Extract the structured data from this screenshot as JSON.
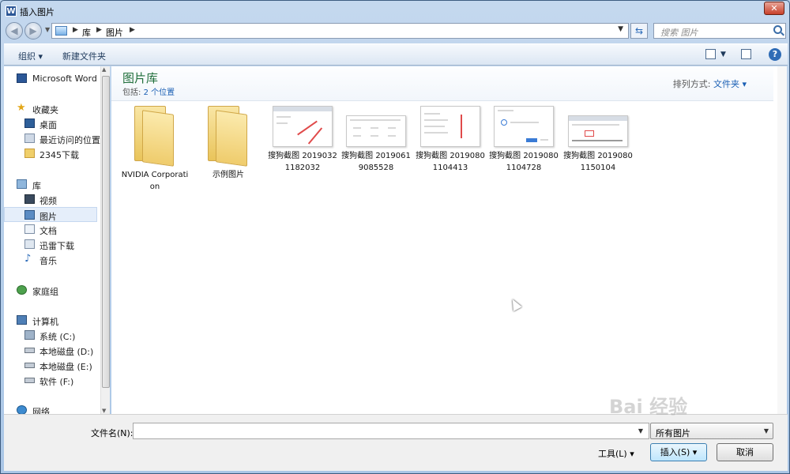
{
  "window": {
    "title": "插入图片",
    "app_icon_letter": "W",
    "close_label": "✕"
  },
  "navbar": {
    "breadcrumbs": [
      "库",
      "图片"
    ],
    "search_placeholder": "搜索 图片"
  },
  "toolbar": {
    "organize": "组织",
    "new_folder": "新建文件夹"
  },
  "sidebar": {
    "items": [
      {
        "label": "Microsoft Word",
        "icon": "word-icon",
        "level": 0
      },
      {
        "label": "收藏夹",
        "icon": "star-icon",
        "level": 0
      },
      {
        "label": "桌面",
        "icon": "desktop-icon",
        "level": 1
      },
      {
        "label": "最近访问的位置",
        "icon": "recent-places-icon",
        "level": 1
      },
      {
        "label": "2345下载",
        "icon": "folder-icon",
        "level": 1
      },
      {
        "label": "库",
        "icon": "library-icon",
        "level": 0
      },
      {
        "label": "视频",
        "icon": "video-icon",
        "level": 1
      },
      {
        "label": "图片",
        "icon": "pictures-icon",
        "level": 1,
        "selected": true
      },
      {
        "label": "文档",
        "icon": "documents-icon",
        "level": 1
      },
      {
        "label": "迅雷下载",
        "icon": "download-folder-icon",
        "level": 1
      },
      {
        "label": "音乐",
        "icon": "music-icon",
        "level": 1
      },
      {
        "label": "家庭组",
        "icon": "homegroup-icon",
        "level": 0
      },
      {
        "label": "计算机",
        "icon": "computer-icon",
        "level": 0
      },
      {
        "label": "系统 (C:)",
        "icon": "drive-c-icon",
        "level": 1
      },
      {
        "label": "本地磁盘 (D:)",
        "icon": "drive-icon",
        "level": 1
      },
      {
        "label": "本地磁盘 (E:)",
        "icon": "drive-icon",
        "level": 1
      },
      {
        "label": "软件 (F:)",
        "icon": "drive-icon",
        "level": 1
      },
      {
        "label": "网络",
        "icon": "network-icon",
        "level": 0
      }
    ]
  },
  "library": {
    "title": "图片库",
    "includes_label": "包括:",
    "includes_link": "2 个位置",
    "arrange_label": "排列方式:",
    "arrange_value": "文件夹"
  },
  "files": [
    {
      "name": "NVIDIA Corporation",
      "kind": "folder"
    },
    {
      "name": "示例图片",
      "kind": "folder"
    },
    {
      "name": "搜狗截图 20190321182032",
      "kind": "screenshot"
    },
    {
      "name": "搜狗截图 20190619085528",
      "kind": "screenshot"
    },
    {
      "name": "搜狗截图 20190801104413",
      "kind": "screenshot"
    },
    {
      "name": "搜狗截图 20190801104728",
      "kind": "screenshot"
    },
    {
      "name": "搜狗截图 20190801150104",
      "kind": "screenshot"
    }
  ],
  "bottom": {
    "filename_label": "文件名(N):",
    "filename_value": "",
    "filetype_value": "所有图片",
    "tools_label": "工具(L)",
    "insert_label": "插入(S)",
    "cancel_label": "取消"
  },
  "watermark": "Bai 经验"
}
